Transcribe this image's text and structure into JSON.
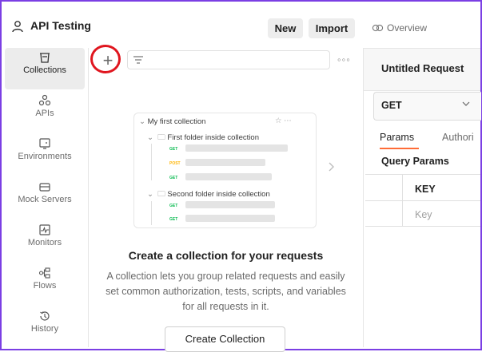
{
  "workspace": {
    "title": "API Testing",
    "new_label": "New",
    "import_label": "Import"
  },
  "sidebar": {
    "items": [
      {
        "label": "Collections",
        "icon": "collections-icon",
        "active": true
      },
      {
        "label": "APIs",
        "icon": "apis-icon"
      },
      {
        "label": "Environments",
        "icon": "environments-icon"
      },
      {
        "label": "Mock Servers",
        "icon": "mock-servers-icon"
      },
      {
        "label": "Monitors",
        "icon": "monitors-icon"
      },
      {
        "label": "Flows",
        "icon": "flows-icon"
      },
      {
        "label": "History",
        "icon": "history-icon"
      }
    ]
  },
  "collections_panel": {
    "search_placeholder": "",
    "illustration": {
      "collection_name": "My first collection",
      "folder1": "First folder inside collection",
      "folder2": "Second folder inside collection",
      "methods": [
        "GET",
        "POST",
        "GET",
        "GET",
        "GET"
      ]
    },
    "empty_title": "Create a collection for your requests",
    "empty_description": "A collection lets you group related requests and easily set common authorization, tests, scripts, and variables for all requests in it.",
    "create_button": "Create Collection"
  },
  "right_pane": {
    "overview_tab": "Overview",
    "request_tab_title": "Untitled Request",
    "method": "GET",
    "sub_tabs": [
      "Params",
      "Authori"
    ],
    "active_sub_tab": "Params",
    "query_params_title": "Query Params",
    "key_header": "KEY",
    "key_placeholder": "Key"
  },
  "colors": {
    "accent_orange": "#ff6c37",
    "annotation_red": "#e0161f",
    "frame_purple": "#7b3fe4",
    "post_method": "#ffb400",
    "get_method": "#0cbb52"
  }
}
